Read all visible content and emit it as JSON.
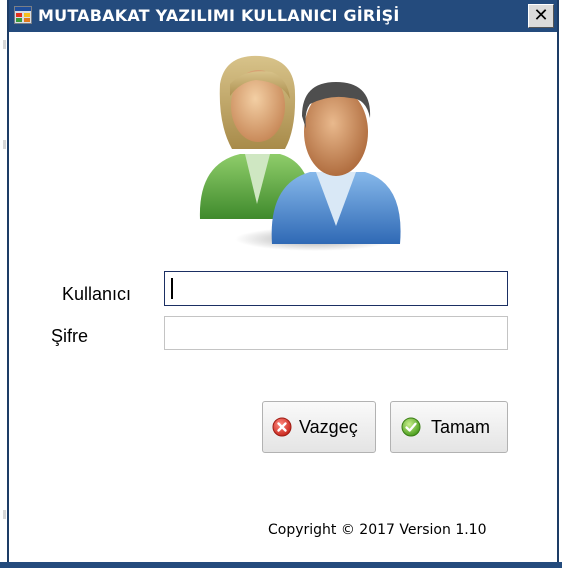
{
  "window": {
    "title": "MUTABAKAT YAZILIMI KULLANICI GİRİŞİ",
    "close_label": "✕",
    "title_bar_color": "#244b7d"
  },
  "form": {
    "user_label": "Kullanıcı",
    "user_value": "",
    "password_label": "Şifre",
    "password_value": ""
  },
  "buttons": {
    "cancel_label": "Vazgeç",
    "cancel_icon": "error-x-icon",
    "ok_label": "Tamam",
    "ok_icon": "check-icon"
  },
  "footer": {
    "copyright": "Copyright © 2017  Version 1.10"
  },
  "avatar_icon": "users-icon"
}
